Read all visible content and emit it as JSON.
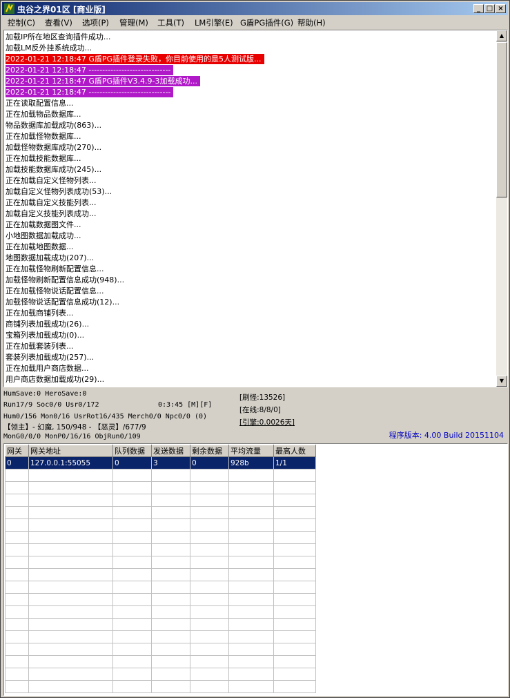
{
  "window": {
    "title": "虫谷之界01区 [商业版]"
  },
  "menu": [
    "控制(C)",
    "查看(V)",
    "选项(P)",
    "管理(M)",
    "工具(T)",
    "LM引擎(E)",
    "G盾PG插件(G)",
    "帮助(H)"
  ],
  "colors": {
    "error_bg": "#e80000",
    "highlight_bg": "#b019c8",
    "selection": "#0a246a",
    "version_text": "#0000c0"
  },
  "log": [
    {
      "text": "加载IP所在地区查询插件成功...",
      "style": "normal"
    },
    {
      "text": "加载LM反外挂系统成功...",
      "style": "normal"
    },
    {
      "text": "2022-01-21 12:18:47 G盾PG插件登录失败，你目前使用的是5人测试版...",
      "style": "red"
    },
    {
      "text": "2022-01-21 12:18:47 ------------------------------",
      "style": "purple"
    },
    {
      "text": "2022-01-21 12:18:47 G盾PG插件V3.4.9-3加载成功...",
      "style": "purple"
    },
    {
      "text": "2022-01-21 12:18:47 ------------------------------",
      "style": "purple"
    },
    {
      "text": "正在读取配置信息...",
      "style": "normal"
    },
    {
      "text": "正在加载物品数据库...",
      "style": "normal"
    },
    {
      "text": "物品数据库加载成功(863)...",
      "style": "normal"
    },
    {
      "text": "正在加载怪物数据库...",
      "style": "normal"
    },
    {
      "text": "加载怪物数据库成功(270)...",
      "style": "normal"
    },
    {
      "text": "正在加载技能数据库...",
      "style": "normal"
    },
    {
      "text": "加载技能数据库成功(245)...",
      "style": "normal"
    },
    {
      "text": "正在加载自定义怪物列表...",
      "style": "normal"
    },
    {
      "text": "加载自定义怪物列表成功(53)...",
      "style": "normal"
    },
    {
      "text": "正在加载自定义技能列表...",
      "style": "normal"
    },
    {
      "text": "加载自定义技能列表成功...",
      "style": "normal"
    },
    {
      "text": "正在加载数据图文件...",
      "style": "normal"
    },
    {
      "text": "小地图数据加载成功...",
      "style": "normal"
    },
    {
      "text": "正在加载地图数据...",
      "style": "normal"
    },
    {
      "text": "地图数据加载成功(207)...",
      "style": "normal"
    },
    {
      "text": "正在加载怪物刷新配置信息...",
      "style": "normal"
    },
    {
      "text": "加载怪物刷新配置信息成功(948)...",
      "style": "normal"
    },
    {
      "text": "正在加载怪物说话配置信息...",
      "style": "normal"
    },
    {
      "text": "加载怪物说话配置信息成功(12)...",
      "style": "normal"
    },
    {
      "text": "正在加载商铺列表...",
      "style": "normal"
    },
    {
      "text": "商铺列表加载成功(26)...",
      "style": "normal"
    },
    {
      "text": "宝箱列表加载成功(0)...",
      "style": "normal"
    },
    {
      "text": "正在加载套装列表...",
      "style": "normal"
    },
    {
      "text": "套装列表加载成功(257)...",
      "style": "normal"
    },
    {
      "text": "正在加载用户商店数据...",
      "style": "normal"
    },
    {
      "text": "用户商店数据加载成功(29)...",
      "style": "normal"
    }
  ],
  "status": {
    "line1": "HumSave:0 HeroSave:0",
    "line2": "Run17/9 Soc0/0 Usr0/172",
    "timer": "0:3:45 [M][F]",
    "line3": "Hum0/156 Mon0/16 UsrRot16/435 Merch0/0 Npc0/0 (0)",
    "line4": "【领主】- 幻魔, 150/948 - 【恶灵】/677/9",
    "line5": "MonG0/0/0 MonP0/16/16 ObjRun0/109",
    "refresh": "[刷怪:13526]",
    "online": "[在线:8/8/0]",
    "engine": "[引擎:0.0026天]",
    "version": "程序版本: 4.00 Build 20151104"
  },
  "table": {
    "headers": [
      "网关",
      "网关地址",
      "队列数据",
      "发送数据",
      "剩余数据",
      "平均流量",
      "最高人数"
    ],
    "rows": [
      [
        "0",
        "127.0.0.1:55055",
        "0",
        "3",
        "0",
        "928b",
        "1/1"
      ]
    ]
  }
}
